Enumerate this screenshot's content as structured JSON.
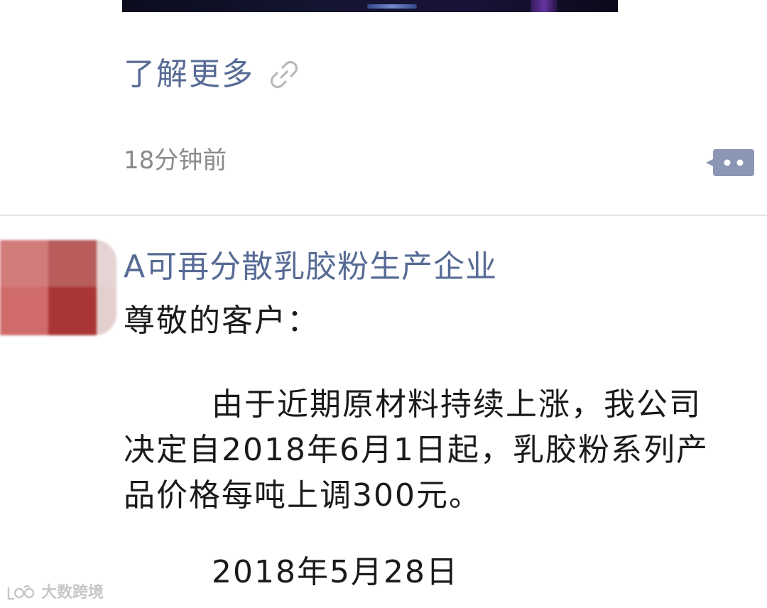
{
  "feed": {
    "previous_post": {
      "learn_more_label": "了解更多",
      "link_icon": "chain-link-icon",
      "timestamp": "18分钟前",
      "comment_icon": "comment-dots-icon"
    },
    "current_post": {
      "author_name": "A可再分散乳胶粉生产企业",
      "body": {
        "greeting": "尊敬的客户：",
        "lines": [
          "由于近期原材料持续上涨，我公司",
          "决定自2018年6月1日起，乳胶粉系列产",
          "品价格每吨上调300元。"
        ],
        "date": "2018年5月28日"
      }
    }
  },
  "watermark": {
    "text": "大数跨境"
  },
  "colors": {
    "link_blue": "#576b95",
    "timestamp_gray": "#8a8a8a",
    "body_text": "#1a1a1a",
    "divider": "#e6e6e6"
  }
}
